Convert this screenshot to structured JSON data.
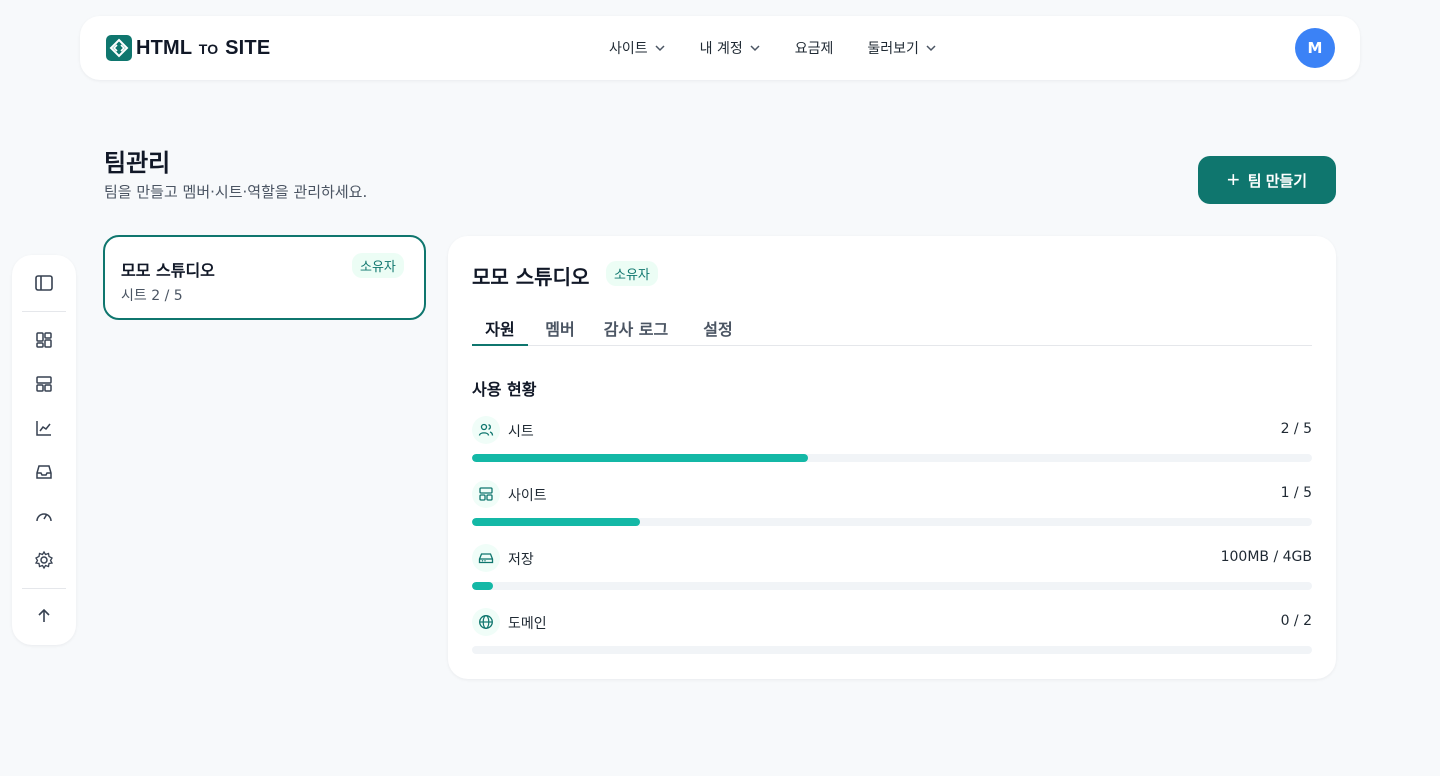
{
  "brand": {
    "logo_main": "HTML",
    "logo_small": "TO",
    "logo_end": "SITE"
  },
  "nav": {
    "items": [
      {
        "label": "사이트",
        "has_dropdown": true
      },
      {
        "label": "내 계정",
        "has_dropdown": true
      },
      {
        "label": "요금제",
        "has_dropdown": false
      },
      {
        "label": "둘러보기",
        "has_dropdown": true
      }
    ]
  },
  "user": {
    "avatar_initial": "M",
    "avatar_color": "#3b82f6"
  },
  "header": {
    "title": "팀관리",
    "subtitle": "팀을 만들고 멤버·시트·역할을 관리하세요.",
    "create_button_label": "팀 만들기",
    "create_button_icon": "plus-icon"
  },
  "side_rail": {
    "icons": [
      "sidebar-toggle-icon",
      "dashboard-icon",
      "layout-icon",
      "chart-icon",
      "inbox-icon",
      "gauge-icon",
      "gear-icon",
      "arrow-up-icon"
    ]
  },
  "teams": [
    {
      "name": "모모 스튜디오",
      "role": "소유자",
      "seats_text": "시트 2 / 5"
    }
  ],
  "panel": {
    "team_name": "모모 스튜디오",
    "role": "소유자",
    "tabs": [
      {
        "label": "자원",
        "active": true
      },
      {
        "label": "멤버",
        "active": false
      },
      {
        "label": "감사 로그",
        "active": false
      },
      {
        "label": "설정",
        "active": false
      }
    ],
    "section_title": "사용 현황",
    "resources": [
      {
        "icon": "users-icon",
        "label": "시트",
        "value": "2 / 5",
        "fraction": 0.4
      },
      {
        "icon": "layout-icon",
        "label": "사이트",
        "value": "1 / 5",
        "fraction": 0.2
      },
      {
        "icon": "storage-icon",
        "label": "저장",
        "value": "100MB / 4GB",
        "fraction": 0.025
      },
      {
        "icon": "globe-icon",
        "label": "도메인",
        "value": "0 / 2",
        "fraction": 0
      }
    ]
  },
  "colors": {
    "accent": "#0f766e",
    "progress": "#14b8a6",
    "badge_bg": "#ecfdf5"
  }
}
